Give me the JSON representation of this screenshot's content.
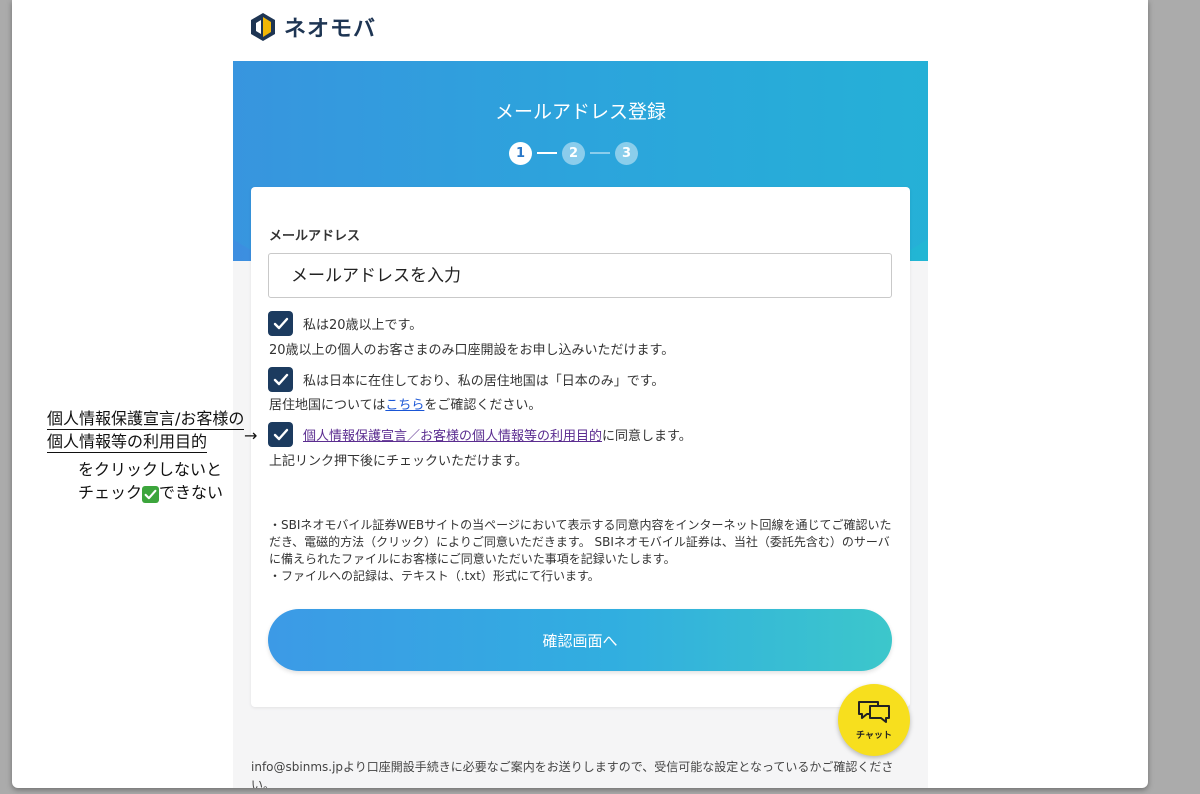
{
  "brand": {
    "name": "ネオモバ",
    "icon": "neomoba-logo-icon"
  },
  "header": {
    "title": "メールアドレス登録"
  },
  "steps": [
    "1",
    "2",
    "3"
  ],
  "form": {
    "email_label": "メールアドレス",
    "email_placeholder": "メールアドレスを入力",
    "checks": [
      {
        "text": "私は20歳以上です。",
        "note": "20歳以上の個人のお客さまのみ口座開設をお申し込みいただけます。"
      },
      {
        "text": "私は日本に在住しており、私の居住地国は「日本のみ」です。",
        "note_pre": "居住地国については",
        "note_link": "こちら",
        "note_post": "をご確認ください。"
      },
      {
        "link": "個人情報保護宣言／お客様の個人情報等の利用目的",
        "text_post": "に同意します。",
        "note": "上記リンク押下後にチェックいただけます。"
      }
    ],
    "legal": [
      "・SBIネオモバイル証券WEBサイトの当ページにおいて表示する同意内容をインターネット回線を通じてご確認いただき、電磁的方法（クリック）によりご同意いただきます。 SBIネオモバイル証券は、当社（委託先含む）のサーバに備えられたファイルにお客様にご同意いただいた事項を記録いたします。",
      "・ファイルへの記録は、テキスト（.txt）形式にて行います。"
    ],
    "submit_label": "確認画面へ"
  },
  "footer": {
    "note_line1": "info@sbinms.jpより口座開設手続きに必要なご案内をお送りしますので、受信可能な設定となっているかご確認くださ",
    "note_line2": "い。"
  },
  "chat": {
    "label": "チャット",
    "icon": "chat-bubble-icon",
    "color": "#f7df1e"
  },
  "annotation": {
    "line1": "個人情報保護宣言/お客様の",
    "line2": "個人情報等の利用目的",
    "arrow": "→",
    "line3": "をクリックしないと",
    "line4_pre": "チェック",
    "line4_post": "できない"
  },
  "colors": {
    "brand_navy": "#1c3b5f",
    "hero_start": "#3d8ee0",
    "hero_end": "#22b6d4",
    "link_blue": "#1a56d6",
    "link_purple": "#5b2d90"
  }
}
